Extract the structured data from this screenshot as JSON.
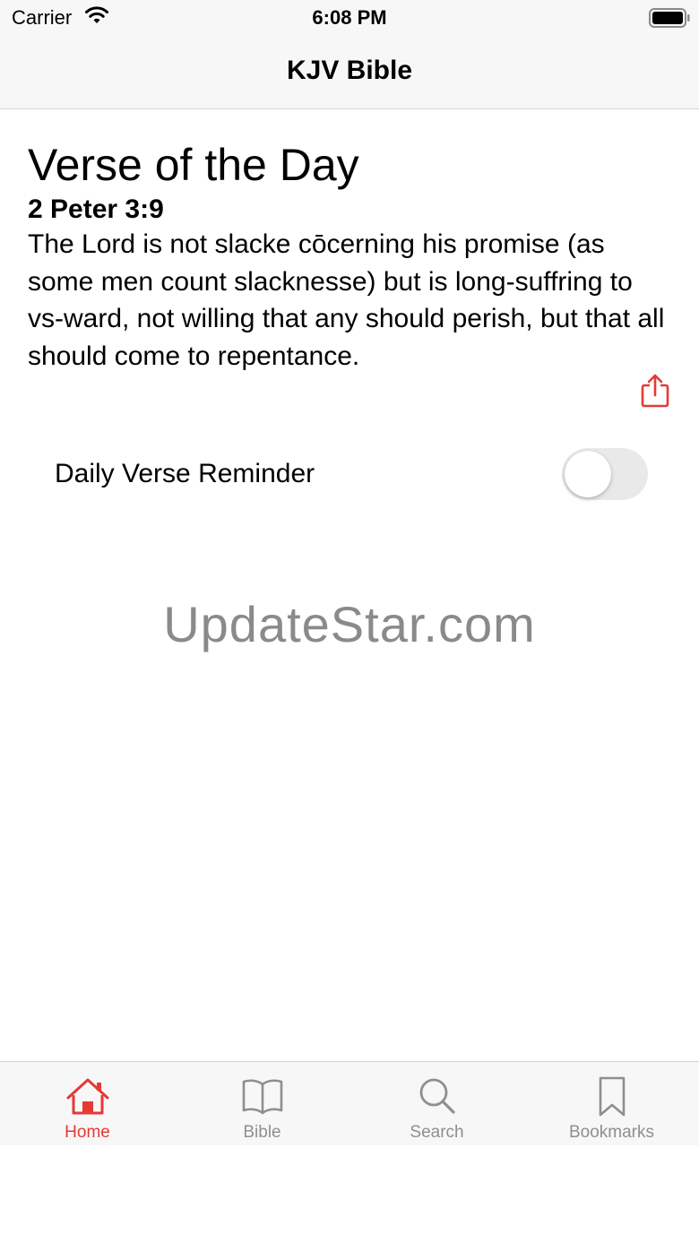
{
  "status_bar": {
    "carrier": "Carrier",
    "time": "6:08 PM"
  },
  "nav": {
    "title": "KJV Bible"
  },
  "verse_of_day": {
    "heading": "Verse of the Day",
    "reference": "2 Peter 3:9",
    "text": "The Lord is not slacke cōcerning his promise (as some men count slacknesse) but is long-suffring to vs-ward, not willing that any should perish, but that all should come to repentance."
  },
  "reminder": {
    "label": "Daily Verse Reminder",
    "enabled": false
  },
  "watermark": "UpdateStar.com",
  "tabs": [
    {
      "label": "Home",
      "icon": "house-icon",
      "active": true
    },
    {
      "label": "Bible",
      "icon": "book-icon",
      "active": false
    },
    {
      "label": "Search",
      "icon": "search-icon",
      "active": false
    },
    {
      "label": "Bookmarks",
      "icon": "bookmark-icon",
      "active": false
    }
  ],
  "colors": {
    "accent": "#e53935",
    "inactive": "#8e8e93",
    "bar_background": "#f7f7f7"
  }
}
